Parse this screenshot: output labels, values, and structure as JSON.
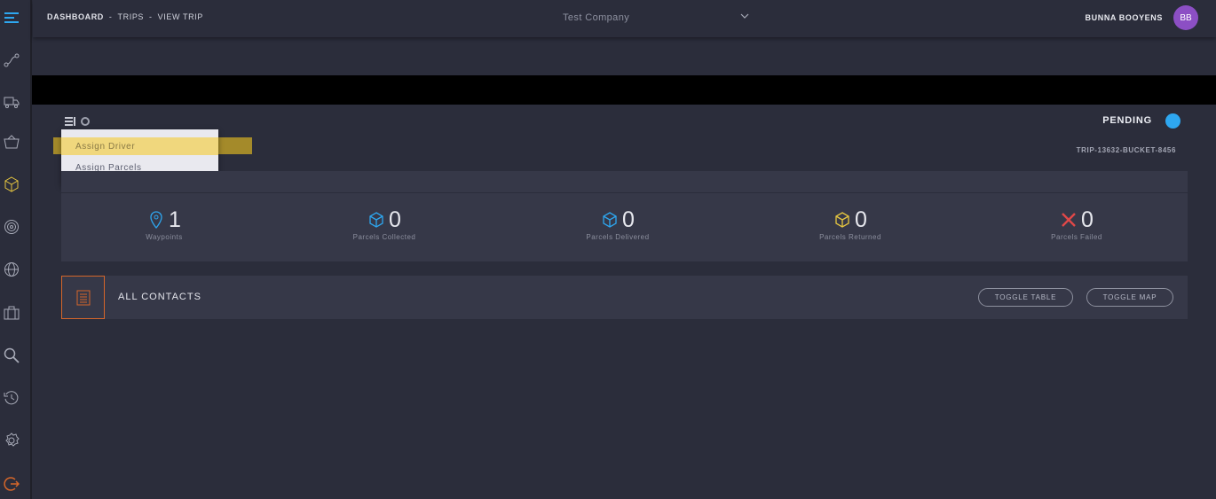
{
  "breadcrumb": {
    "items": [
      "DASHBOARD",
      "TRIPS",
      "VIEW TRIP"
    ],
    "separator": "-"
  },
  "company_select": {
    "value": "Test Company"
  },
  "user": {
    "name": "BUNNA BOOYENS",
    "initials": "BB",
    "avatar_color": "#8c4fc4"
  },
  "sidebar": {
    "icons": [
      "menu-icon",
      "route-icon",
      "truck-icon",
      "basket-icon",
      "box-icon",
      "fingerprint-icon",
      "globe-icon",
      "briefcase-icon",
      "search-icon",
      "history-icon",
      "settings-icon",
      "logout-icon"
    ]
  },
  "dropdown": {
    "items": [
      "Assign Driver",
      "Assign Parcels"
    ],
    "active_index": 0
  },
  "trip": {
    "status": "PENDING",
    "status_color": "#2ea7f0",
    "id": "TRIP-13632-BUCKET-8456"
  },
  "stats": [
    {
      "icon": "pin-icon",
      "value": "1",
      "label": "Waypoints",
      "color": "#2ea7f0"
    },
    {
      "icon": "cube-icon",
      "value": "0",
      "label": "Parcels Collected",
      "color": "#2ea7f0"
    },
    {
      "icon": "cube-icon",
      "value": "0",
      "label": "Parcels Delivered",
      "color": "#2ea7f0"
    },
    {
      "icon": "cube-icon",
      "value": "0",
      "label": "Parcels Returned",
      "color": "#e8c840"
    },
    {
      "icon": "x-icon",
      "value": "0",
      "label": "Parcels Failed",
      "color": "#e04848"
    }
  ],
  "contacts": {
    "title": "ALL CONTACTS",
    "toggle_table": "TOGGLE TABLE",
    "toggle_map": "TOGGLE MAP"
  }
}
